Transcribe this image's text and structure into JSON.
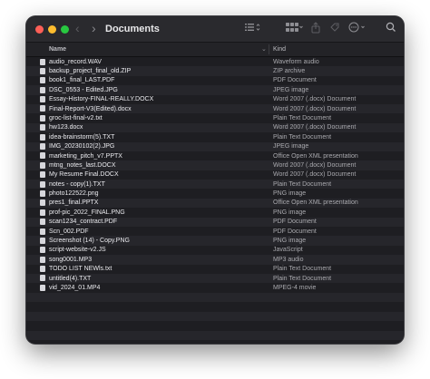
{
  "window": {
    "title": "Documents"
  },
  "toolbar": {
    "back_icon": "chevron-left-icon",
    "forward_icon": "chevron-right-icon",
    "view_icon": "list-view-icon",
    "group_icon": "grid-group-icon",
    "share_icon": "share-icon",
    "tag_icon": "tag-icon",
    "more_icon": "ellipsis-circle-icon",
    "search_icon": "search-icon"
  },
  "columns": {
    "name": "Name",
    "kind": "Kind"
  },
  "files": [
    {
      "name": "audio_record.WAV",
      "kind": "Waveform audio"
    },
    {
      "name": "backup_project_final_old.ZIP",
      "kind": "ZIP archive"
    },
    {
      "name": "book1_final_LAST.PDF",
      "kind": "PDF Document"
    },
    {
      "name": "DSC_0553 - Edited.JPG",
      "kind": "JPEG image"
    },
    {
      "name": "Essay-History-FINAL-REALLY.DOCX",
      "kind": "Word 2007 (.docx) Document"
    },
    {
      "name": "Final-Report-V3(Edited).docx",
      "kind": "Word 2007 (.docx) Document"
    },
    {
      "name": "groc-list-final-v2.txt",
      "kind": "Plain Text Document"
    },
    {
      "name": "hw123.docx",
      "kind": "Word 2007 (.docx) Document"
    },
    {
      "name": "idea-brainstorm(5).TXT",
      "kind": "Plain Text Document"
    },
    {
      "name": "IMG_20230102(2).JPG",
      "kind": "JPEG image"
    },
    {
      "name": "marketing_pitch_v7.PPTX",
      "kind": "Office Open XML presentation"
    },
    {
      "name": "mtng_notes_last.DOCX",
      "kind": "Word 2007 (.docx) Document"
    },
    {
      "name": "My Resume Final.DOCX",
      "kind": "Word 2007 (.docx) Document"
    },
    {
      "name": "notes - copy(1).TXT",
      "kind": "Plain Text Document"
    },
    {
      "name": "photo122522.png",
      "kind": "PNG image"
    },
    {
      "name": "pres1_final.PPTX",
      "kind": "Office Open XML presentation"
    },
    {
      "name": "prof-pic_2022_FINAL.PNG",
      "kind": "PNG image"
    },
    {
      "name": "scan1234_contract.PDF",
      "kind": "PDF Document"
    },
    {
      "name": "Scn_002.PDF",
      "kind": "PDF Document"
    },
    {
      "name": "Screenshot (14) - Copy.PNG",
      "kind": "PNG image"
    },
    {
      "name": "script-website-v2.JS",
      "kind": "JavaScript"
    },
    {
      "name": "song0001.MP3",
      "kind": "MP3 audio"
    },
    {
      "name": "TODO LIST NEWls.txt",
      "kind": "Plain Text Document"
    },
    {
      "name": "untitled(4).TXT",
      "kind": "Plain Text Document"
    },
    {
      "name": "vid_2024_01.MP4",
      "kind": "MPEG-4 movie"
    }
  ],
  "colors": {
    "window_bg": "#1e1e22",
    "toolbar_bg": "#2a2a2e",
    "row_alt": "#26262b",
    "close": "#fe5f57",
    "minimize": "#febc2e",
    "zoom": "#28c840"
  }
}
